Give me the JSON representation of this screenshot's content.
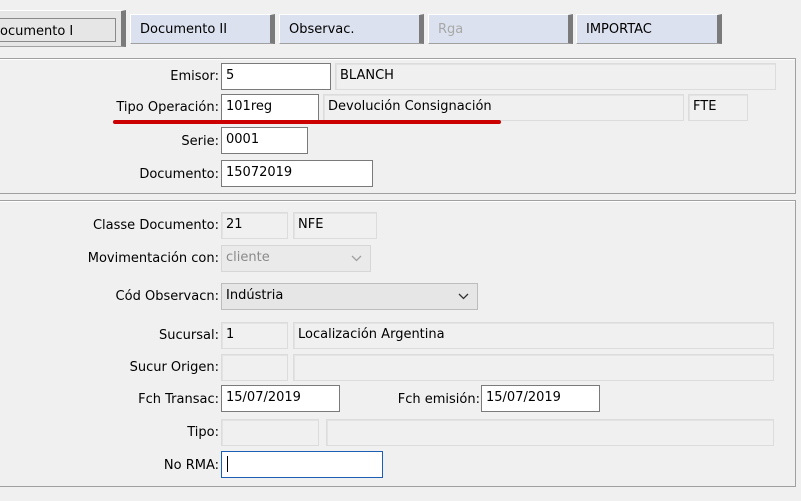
{
  "tabs": [
    {
      "label": "ocumento  I"
    },
    {
      "label": "Documento II"
    },
    {
      "label": "Observac."
    },
    {
      "label": "Rga"
    },
    {
      "label": "IMPORTAC"
    }
  ],
  "header": {
    "emisor": {
      "label": "Emisor:",
      "code": "5",
      "name": "BLANCH"
    },
    "tipo_operacion": {
      "label": "Tipo Operación:",
      "code": "101reg",
      "description": "Devolución Consignación",
      "extra": "FTE"
    },
    "serie": {
      "label": "Serie:",
      "value": "0001"
    },
    "documento": {
      "label": "Documento:",
      "value": "15072019"
    }
  },
  "details": {
    "classe_documento": {
      "label": "Classe Documento:",
      "code": "21",
      "name": "NFE"
    },
    "movimentacion": {
      "label": "Movimentación con:",
      "value": "cliente"
    },
    "cod_observacion": {
      "label": "Cód Observacn:",
      "value": "Indústria"
    },
    "sucursal": {
      "label": "Sucursal:",
      "code": "1",
      "name": "Localización Argentina"
    },
    "sucur_origen": {
      "label": "Sucur Origen:",
      "code": "",
      "name": ""
    },
    "fch_transac": {
      "label": "Fch Transac:",
      "value": "15/07/2019"
    },
    "fch_emision": {
      "label": "Fch emisión:",
      "value": "15/07/2019"
    },
    "tipo": {
      "label": "Tipo:",
      "code": "",
      "name": ""
    },
    "no_rma": {
      "label": "No RMA:",
      "value": ""
    }
  },
  "colors": {
    "annotation_underline": "#cc0000",
    "tab_background": "#dbe1ef",
    "focus_border": "#1a5fb4"
  },
  "icons": {
    "combo": "chevron-down-icon"
  }
}
